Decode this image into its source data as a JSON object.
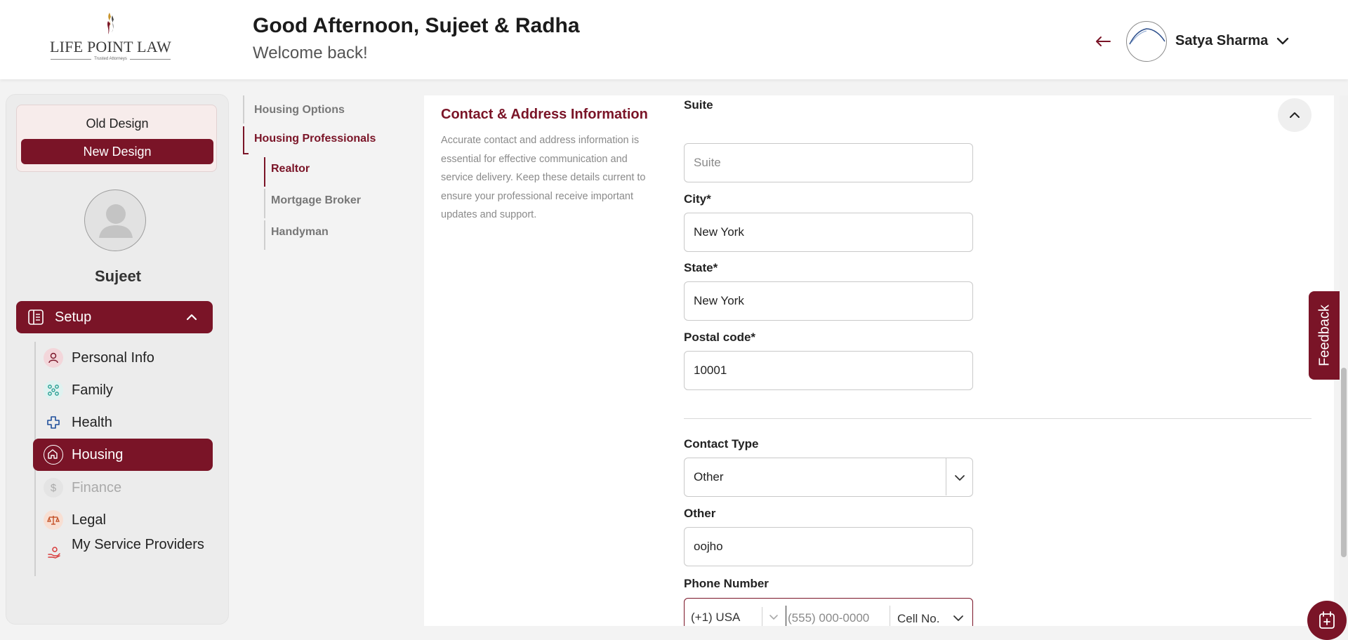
{
  "header": {
    "logo_text": "LIFE POINT LAW",
    "logo_tagline": "Trusted Attorneys",
    "greeting": "Good Afternoon, Sujeet & Radha",
    "subgreeting": "Welcome back!",
    "user_name": "Satya Sharma"
  },
  "sidebar": {
    "old_design_label": "Old Design",
    "new_design_label": "New Design",
    "profile_name": "Sujeet",
    "setup_label": "Setup",
    "items": [
      {
        "label": "Personal Info",
        "icon": "person-icon"
      },
      {
        "label": "Family",
        "icon": "family-icon"
      },
      {
        "label": "Health",
        "icon": "health-cross-icon"
      },
      {
        "label": "Housing",
        "icon": "house-icon",
        "active": true
      },
      {
        "label": "Finance",
        "icon": "dollar-icon",
        "disabled": true
      },
      {
        "label": "Legal",
        "icon": "scales-icon"
      },
      {
        "label": "My Service Providers",
        "icon": "service-hand-icon"
      }
    ]
  },
  "subnav": {
    "items": [
      {
        "label": "Housing Options"
      },
      {
        "label": "Housing Professionals",
        "active": true
      },
      {
        "label": "Realtor",
        "active": true
      },
      {
        "label": "Mortgage Broker"
      },
      {
        "label": "Handyman"
      }
    ]
  },
  "section": {
    "title": "Contact & Address Information",
    "description": "Accurate contact and address information is essential for effective communication and service delivery. Keep these details current to ensure your professional receive important updates and support.",
    "suite_label": "Suite",
    "suite_placeholder": "Suite",
    "city_label": "City*",
    "city_value": "New York",
    "state_label": "State*",
    "state_value": "New York",
    "postal_label": "Postal code*",
    "postal_value": "10001",
    "contact_type_label": "Contact Type",
    "contact_type_value": "Other",
    "other_label": "Other",
    "other_value": "oojho",
    "phone_label": "Phone Number",
    "phone_country": "(+1) USA",
    "phone_placeholder": "(555) 000-0000",
    "phone_type": "Cell No."
  },
  "feedback_label": "Feedback",
  "colors": {
    "brand": "#7a1427",
    "background": "#f3f3f3"
  }
}
